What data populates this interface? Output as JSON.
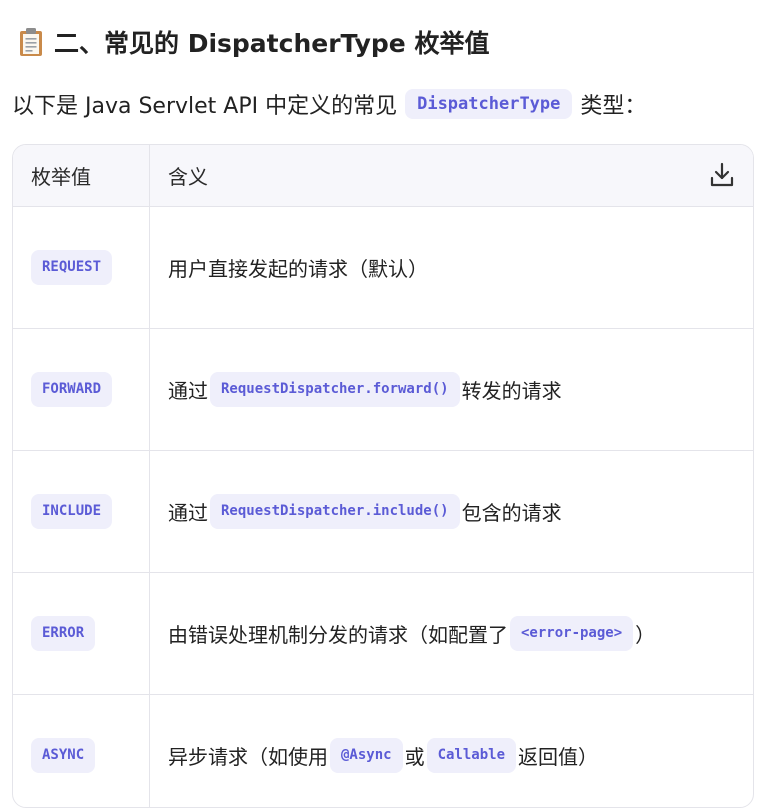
{
  "heading": {
    "icon": "clipboard-icon",
    "text": "二、常见的 DispatcherType 枚举值"
  },
  "intro": {
    "before": "以下是 Java Servlet API 中定义的常见",
    "code": "DispatcherType",
    "after": "类型："
  },
  "table": {
    "headers": [
      "枚举值",
      "含义"
    ],
    "download_icon": "download-icon",
    "rows": [
      {
        "value": "REQUEST",
        "t1": "用户直接发起的请求（默认）"
      },
      {
        "value": "FORWARD",
        "t1": "通过",
        "c1": "RequestDispatcher.forward()",
        "t2": "转发的请求"
      },
      {
        "value": "INCLUDE",
        "t1": "通过",
        "c1": "RequestDispatcher.include()",
        "t2": "包含的请求"
      },
      {
        "value": "ERROR",
        "t1": "由错误处理机制分发的请求（如配置了",
        "c1": "<error-page>",
        "t2": "）"
      },
      {
        "value": "ASYNC",
        "t1": "异步请求（如使用",
        "c1": "@Async",
        "t2": "或",
        "c2": "Callable",
        "t3": "返回值）"
      }
    ]
  }
}
